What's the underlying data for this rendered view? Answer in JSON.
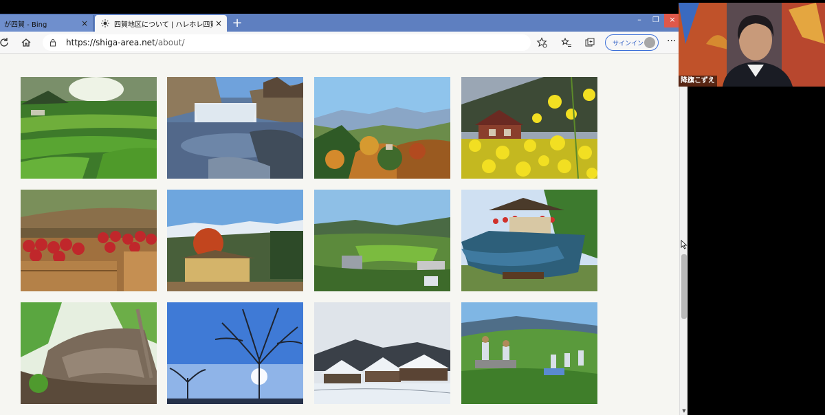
{
  "browser": {
    "tabs": [
      {
        "label": "が四賀 - Bing",
        "active": false
      },
      {
        "label": "四賀地区について | ハレホレ四賀",
        "active": true
      }
    ],
    "new_tab_label": "+",
    "close_glyph": "×",
    "url_host": "https://shiga-area.net",
    "url_path": "/about/",
    "signin_label": "サインイン",
    "more_label": "···"
  },
  "gallery": {
    "photos": [
      {
        "subject": "rice-terraces"
      },
      {
        "subject": "waterfall"
      },
      {
        "subject": "autumn-mountains"
      },
      {
        "subject": "rapeseed-flowers-house"
      },
      {
        "subject": "apple-crates"
      },
      {
        "subject": "snowy-peaks-farmhouse"
      },
      {
        "subject": "valley-village"
      },
      {
        "subject": "festival-float"
      },
      {
        "subject": "rock-cliff-forest"
      },
      {
        "subject": "bare-tree-sky"
      },
      {
        "subject": "snowy-village"
      },
      {
        "subject": "hillside-gathering"
      }
    ]
  },
  "video_call": {
    "participant_name": "降旗こずえ"
  },
  "colors": {
    "tabstrip": "#5e7fc0",
    "accent": "#3b6fd8",
    "close_button": "#e0584a"
  }
}
